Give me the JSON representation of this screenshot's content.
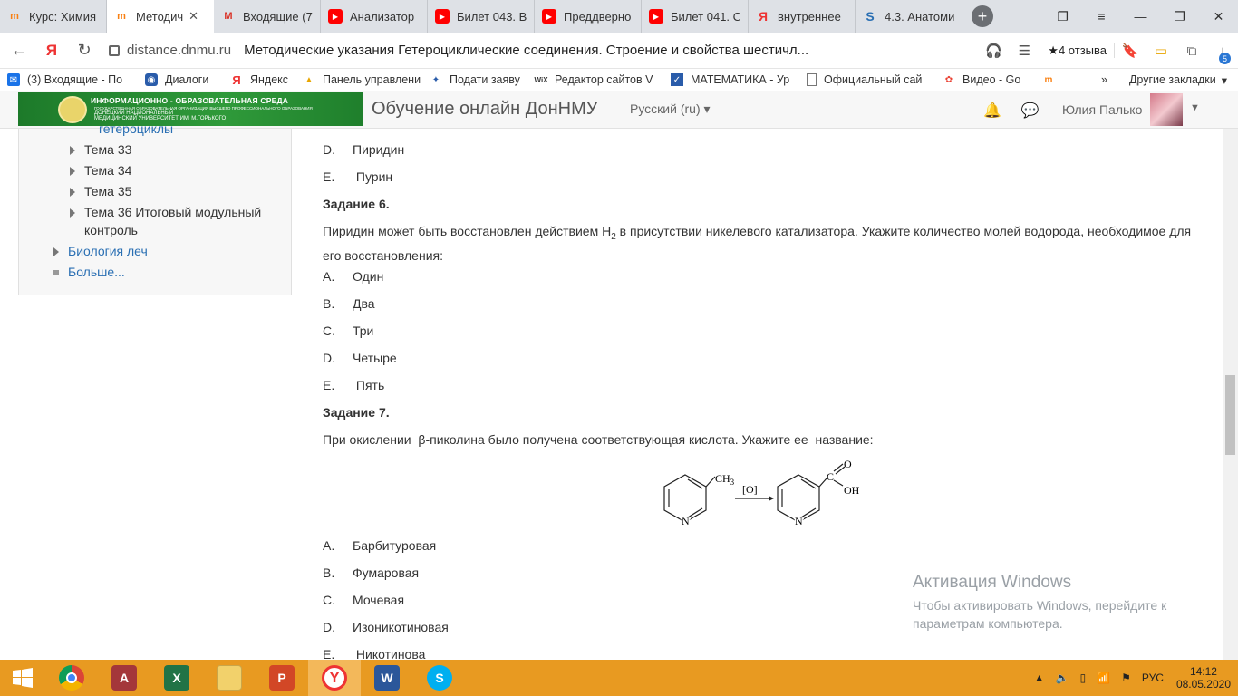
{
  "browser": {
    "tabs": [
      {
        "label": "Курс: Химия",
        "icon": "moodle-icon"
      },
      {
        "label": "Методич",
        "icon": "moodle-icon",
        "active": true
      },
      {
        "label": "Входящие (7",
        "icon": "gmail-icon"
      },
      {
        "label": "Анализатор",
        "icon": "youtube-icon"
      },
      {
        "label": "Билет 043. В",
        "icon": "youtube-icon"
      },
      {
        "label": "Преддверно",
        "icon": "youtube-icon"
      },
      {
        "label": "Билет 041. С",
        "icon": "youtube-icon"
      },
      {
        "label": "внутреннее",
        "icon": "yandex-icon"
      },
      {
        "label": "4.3. Анатоми",
        "icon": "s-icon"
      }
    ],
    "new_tab": "+",
    "yandex_button": "Я",
    "url_host": "distance.dnmu.ru",
    "page_title": "Методические указания Гетероциклические соединения. Строение и свойства шестичл...",
    "reviews": "★4 отзыва",
    "downloads_badge": "5",
    "bookmarks": [
      {
        "label": "(3) Входящие - По"
      },
      {
        "label": "Диалоги"
      },
      {
        "label": "Яндекс"
      },
      {
        "label": "Панель управлени"
      },
      {
        "label": "Подати заяву"
      },
      {
        "label": "Редактор сайтов V"
      },
      {
        "label": "МАТЕМАТИКА - Ур"
      },
      {
        "label": "Официальный сай"
      },
      {
        "label": "Видео - Go"
      }
    ],
    "bookmarks_more": "»",
    "other_bookmarks": "Другие закладки"
  },
  "header": {
    "logo_line1": "ИНФОРМАЦИОННО - ОБРАЗОВАТЕЛЬНАЯ СРЕДА",
    "logo_line2": "ГОСУДАРСТВЕННАЯ ОБРАЗОВАТЕЛЬНАЯ ОРГАНИЗАЦИЯ ВЫСШЕГО ПРОФЕССИОНАЛЬНОГО ОБРАЗОВАНИЯ",
    "logo_line3": "ДОНЕЦКИЙ НАЦИОНАЛЬНЫЙ",
    "logo_line4": "МЕДИЦИНСКИЙ УНИВЕРСИТЕТ ИМ. М.ГОРЬКОГО",
    "site_name": "Обучение онлайн ДонНМУ",
    "language": "Русский (ru)",
    "user_name": "Юлия Палько"
  },
  "sidebar": {
    "cut_item": "гетероциклы",
    "items": [
      {
        "label": "Тема 33"
      },
      {
        "label": "Тема 34"
      },
      {
        "label": "Тема 35"
      },
      {
        "label": "Тема 36 Итоговый модульный"
      },
      {
        "label": "контроль"
      }
    ],
    "bio_link": "Биология леч",
    "more_link": "Больше..."
  },
  "content": {
    "prev_options": [
      {
        "letter": "D.",
        "text": "Пиридин"
      },
      {
        "letter": "E.",
        "text": " Пурин"
      }
    ],
    "task6": {
      "title": "Задание 6.",
      "text_a": "Пиридин может быть восстановлен действием H",
      "sub": "2",
      "text_b": " в присутствии никелевого катализатора. Укажите количество молей водорода, необходимое для",
      "text_c": "его восстановления:",
      "options": [
        {
          "letter": "A.",
          "text": "Один"
        },
        {
          "letter": "B.",
          "text": "Два"
        },
        {
          "letter": "C.",
          "text": "Три"
        },
        {
          "letter": "D.",
          "text": "Четыре"
        },
        {
          "letter": "E.",
          "text": " Пять"
        }
      ]
    },
    "task7": {
      "title": "Задание 7.",
      "text": "При окислении  β-пиколина было получена соответствующая кислота. Укажите ее  название:",
      "scheme": {
        "ch3": "CH",
        "ch3_sub": "3",
        "reagent": "[O]",
        "n1": "N",
        "n2": "N",
        "c": "C",
        "o": "O",
        "oh": "OH"
      },
      "options": [
        {
          "letter": "A.",
          "text": "Барбитуровая"
        },
        {
          "letter": "B.",
          "text": "Фумаровая"
        },
        {
          "letter": "C.",
          "text": "Мочевая"
        },
        {
          "letter": "D.",
          "text": "Изоникотиновая"
        },
        {
          "letter": "E.",
          "text": " Никотинова"
        }
      ]
    }
  },
  "activation": {
    "title": "Активация Windows",
    "line1": "Чтобы активировать Windows, перейдите к",
    "line2": "параметрам компьютера."
  },
  "taskbar": {
    "apps": [
      "chrome-icon",
      "access-icon",
      "excel-icon",
      "explorer-icon",
      "powerpoint-icon",
      "yandex-browser-icon",
      "word-icon",
      "skype-icon"
    ],
    "lang": "РУС",
    "time": "14:12",
    "date": "08.05.2020"
  }
}
